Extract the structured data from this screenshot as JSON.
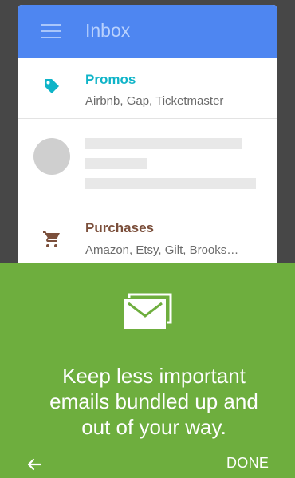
{
  "app": {
    "title": "Inbox"
  },
  "bundles": [
    {
      "title": "Promos",
      "subtitle": "Airbnb, Gap, Ticketmaster",
      "icon": "tag-icon",
      "color": "#0fb4c8"
    },
    {
      "title": "Purchases",
      "subtitle": "Amazon, Etsy, Gilt, Brooks…",
      "icon": "cart-icon",
      "color": "#7b4f3b"
    }
  ],
  "onboarding": {
    "message_lines": [
      "Keep less important",
      "emails bundled up and",
      "out of your way."
    ],
    "done_label": "DONE",
    "icon": "mail-bundle-icon",
    "background": "#6eae3e"
  },
  "colors": {
    "appbar": "#4e86f1",
    "accent": "#6eae3e"
  }
}
